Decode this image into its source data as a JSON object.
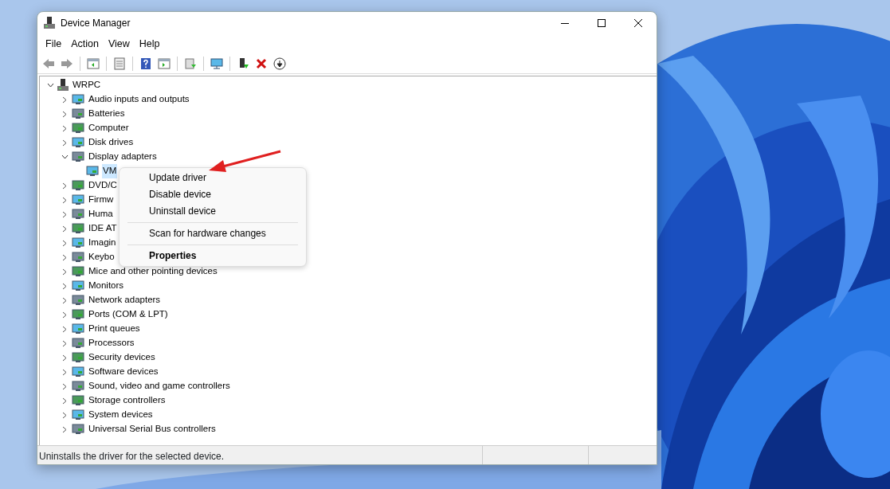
{
  "window": {
    "title": "Device Manager"
  },
  "menu_bar": [
    "File",
    "Action",
    "View",
    "Help"
  ],
  "tree": {
    "label": "WRPC",
    "expanded": true,
    "children": [
      {
        "label": "Audio inputs and outputs",
        "expanded": false
      },
      {
        "label": "Batteries",
        "expanded": false
      },
      {
        "label": "Computer",
        "expanded": false
      },
      {
        "label": "Disk drives",
        "expanded": false
      },
      {
        "label": "Display adapters",
        "expanded": true,
        "children": [
          {
            "label": "VM",
            "selected": true
          }
        ]
      },
      {
        "label": "DVD/C",
        "expanded": false
      },
      {
        "label": "Firmw",
        "expanded": false
      },
      {
        "label": "Huma",
        "expanded": false
      },
      {
        "label": "IDE AT",
        "expanded": false
      },
      {
        "label": "Imagin",
        "expanded": false
      },
      {
        "label": "Keybo",
        "expanded": false
      },
      {
        "label": "Mice and other pointing devices",
        "expanded": false
      },
      {
        "label": "Monitors",
        "expanded": false
      },
      {
        "label": "Network adapters",
        "expanded": false
      },
      {
        "label": "Ports (COM & LPT)",
        "expanded": false
      },
      {
        "label": "Print queues",
        "expanded": false
      },
      {
        "label": "Processors",
        "expanded": false
      },
      {
        "label": "Security devices",
        "expanded": false
      },
      {
        "label": "Software devices",
        "expanded": false
      },
      {
        "label": "Sound, video and game controllers",
        "expanded": false
      },
      {
        "label": "Storage controllers",
        "expanded": false
      },
      {
        "label": "System devices",
        "expanded": false
      },
      {
        "label": "Universal Serial Bus controllers",
        "expanded": false
      }
    ]
  },
  "context_menu": [
    {
      "kind": "item",
      "label": "Update driver",
      "bold": false
    },
    {
      "kind": "item",
      "label": "Disable device",
      "bold": false
    },
    {
      "kind": "item",
      "label": "Uninstall device",
      "bold": false
    },
    {
      "kind": "separator"
    },
    {
      "kind": "item",
      "label": "Scan for hardware changes",
      "bold": false
    },
    {
      "kind": "separator"
    },
    {
      "kind": "item",
      "label": "Properties",
      "bold": true
    }
  ],
  "status_bar": {
    "text": "Uninstalls the driver for the selected device."
  }
}
